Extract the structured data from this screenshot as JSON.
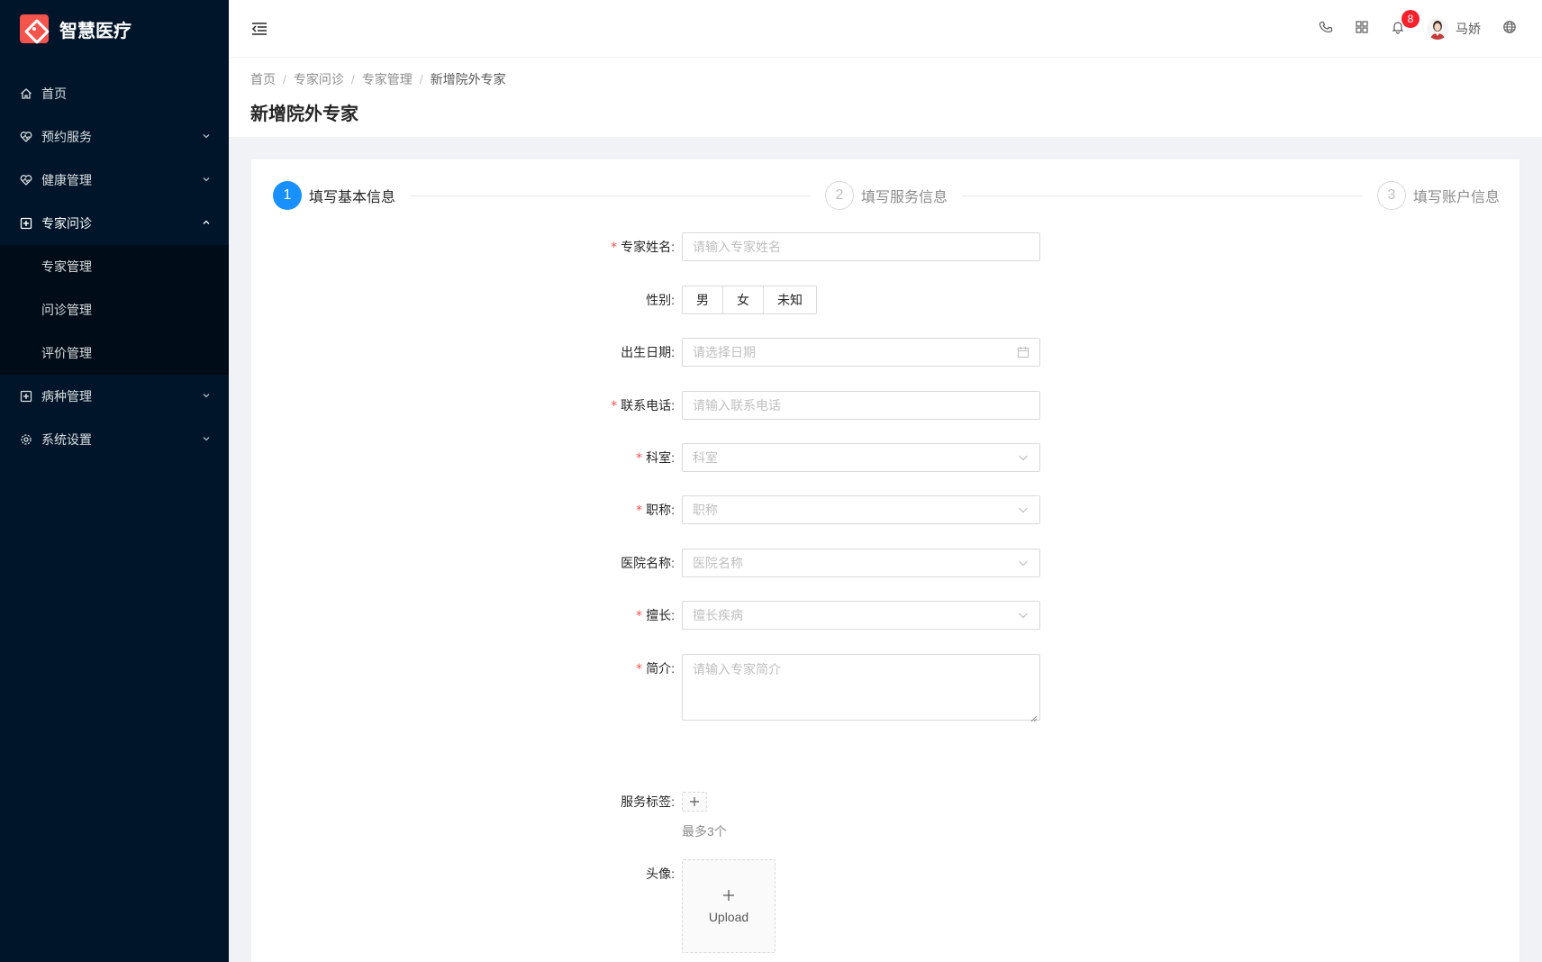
{
  "app": {
    "title": "智慧医疗"
  },
  "sidebar": {
    "items": [
      {
        "label": "首页",
        "icon": "home-icon"
      },
      {
        "label": "预约服务",
        "icon": "heart-icon"
      },
      {
        "label": "健康管理",
        "icon": "heart-pulse-icon"
      },
      {
        "label": "专家问诊",
        "icon": "medical-plus-icon",
        "children": [
          "专家管理",
          "问诊管理",
          "评价管理"
        ]
      },
      {
        "label": "病种管理",
        "icon": "medical-plus-icon"
      },
      {
        "label": "系统设置",
        "icon": "gear-icon"
      }
    ]
  },
  "header": {
    "notification_count": "8",
    "user_name": "马娇"
  },
  "breadcrumb": [
    "首页",
    "专家问诊",
    "专家管理",
    "新增院外专家"
  ],
  "page_title": "新增院外专家",
  "steps": [
    {
      "index": "1",
      "title": "填写基本信息",
      "status": "active"
    },
    {
      "index": "2",
      "title": "填写服务信息",
      "status": "wait"
    },
    {
      "index": "3",
      "title": "填写账户信息",
      "status": "wait"
    }
  ],
  "form": {
    "name": {
      "label": "专家姓名",
      "placeholder": "请输入专家姓名",
      "required": true
    },
    "gender": {
      "label": "性别",
      "options": [
        "男",
        "女",
        "未知"
      ]
    },
    "birth": {
      "label": "出生日期",
      "placeholder": "请选择日期"
    },
    "phone": {
      "label": "联系电话",
      "placeholder": "请输入联系电话",
      "required": true
    },
    "dept": {
      "label": "科室",
      "placeholder": "科室",
      "required": true
    },
    "title": {
      "label": "职称",
      "placeholder": "职称",
      "required": true
    },
    "hospital": {
      "label": "医院名称",
      "placeholder": "医院名称"
    },
    "specialty": {
      "label": "擅长",
      "placeholder": "擅长疾病",
      "required": true
    },
    "intro": {
      "label": "简介",
      "placeholder": "请输入专家简介",
      "required": true
    },
    "tags": {
      "label": "服务标签",
      "help": "最多3个"
    },
    "avatar": {
      "label": "头像",
      "upload_text": "Upload"
    }
  },
  "colors": {
    "primary": "#1890ff",
    "sider_bg": "#001529",
    "required": "#ff4d4f",
    "badge": "#f5222d"
  }
}
